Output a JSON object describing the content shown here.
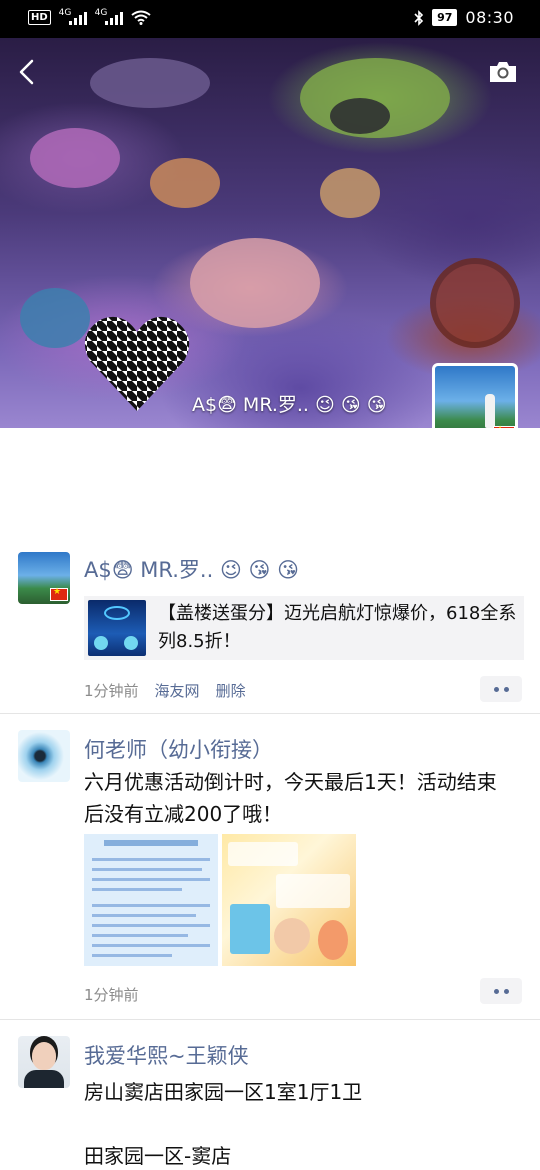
{
  "status_bar": {
    "hd_label": "HD",
    "network_1": "4G",
    "network_2": "4G",
    "battery": "97",
    "time": "08:30"
  },
  "cover": {
    "name": "A$😨 MR.罗.. 😉 😘 😘"
  },
  "posts": [
    {
      "name": "A$😨 MR.罗.. 😉 😘 😘",
      "share_title": "【盖楼送蛋分】迈光启航灯惊爆价，618全系列8.5折！",
      "time": "1分钟前",
      "source": "海友网",
      "delete_label": "删除"
    },
    {
      "name": "何老师（幼小衔接）",
      "text": "六月优惠活动倒计时，今天最后1天！活动结束后没有立减200了哦！",
      "time": "1分钟前"
    },
    {
      "name": "我爱华熙~王颖侠",
      "text_line1": "房山窦店田家园一区1室1厅1卫",
      "text_line2": "田家园一区-窦店"
    }
  ],
  "colors": {
    "name_link": "#576b95",
    "meta_gray": "#8c8c8c",
    "card_bg": "#f3f3f5"
  }
}
